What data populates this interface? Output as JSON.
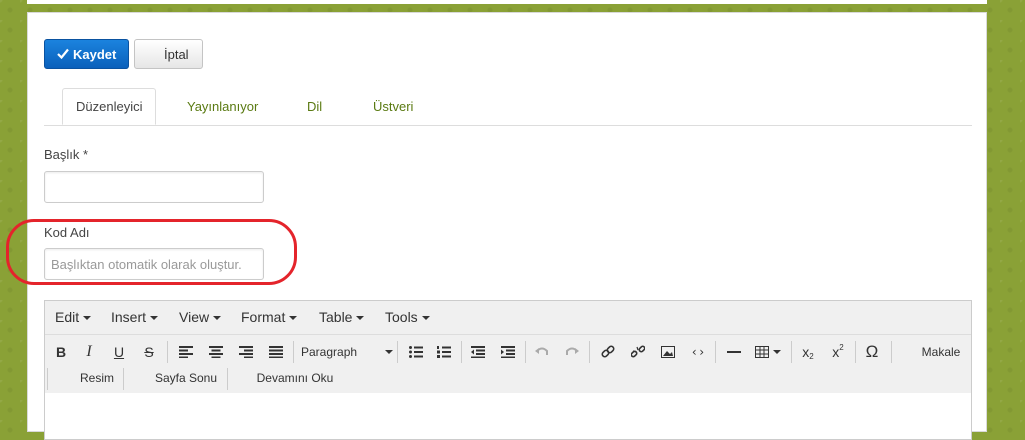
{
  "actions": {
    "save_label": "Kaydet",
    "cancel_label": "İptal"
  },
  "tabs": [
    "Düzenleyici",
    "Yayınlanıyor",
    "Dil",
    "Üstveri"
  ],
  "form": {
    "title_label": "Başlık *",
    "title_value": "",
    "alias_label": "Kod Adı",
    "alias_placeholder": "Başlıktan otomatik olarak oluştur."
  },
  "editor": {
    "menus": [
      "Edit",
      "Insert",
      "View",
      "Format",
      "Table",
      "Tools"
    ],
    "format_select": "Paragraph",
    "buttons": [
      "Makale",
      "Resim",
      "Sayfa Sonu",
      "Devamını Oku"
    ]
  },
  "colors": {
    "accent": "#0a60bb",
    "highlight": "#e4242b",
    "tab_text": "#5a7a12"
  }
}
